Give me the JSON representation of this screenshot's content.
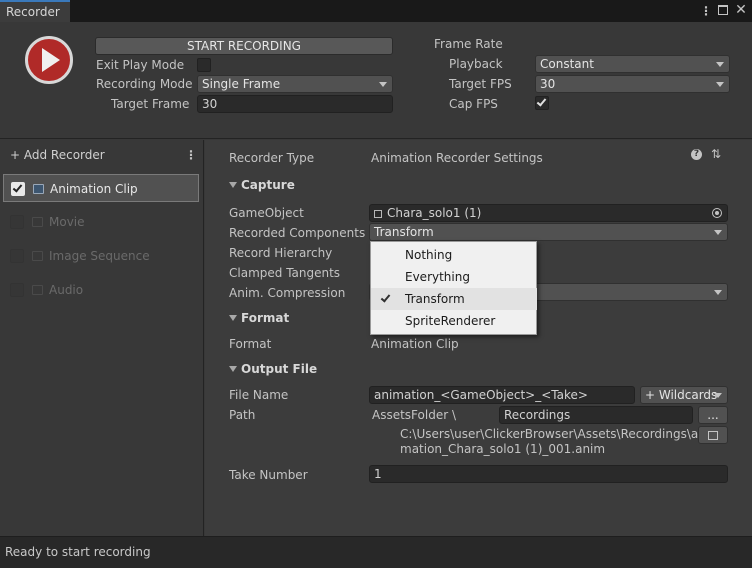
{
  "window": {
    "tab_title": "Recorder"
  },
  "top": {
    "start_button": "START RECORDING",
    "exit_play_mode_label": "Exit Play Mode",
    "exit_play_mode_checked": false,
    "recording_mode_label": "Recording Mode",
    "recording_mode_value": "Single Frame",
    "target_frame_label": "Target Frame",
    "target_frame_value": "30",
    "frame_rate_label": "Frame Rate",
    "playback_label": "Playback",
    "playback_value": "Constant",
    "target_fps_label": "Target FPS",
    "target_fps_value": "30",
    "cap_fps_label": "Cap FPS",
    "cap_fps_checked": true
  },
  "sidebar": {
    "add_recorder": "+ Add Recorder",
    "items": [
      {
        "label": "Animation Clip",
        "enabled": true,
        "selected": true
      },
      {
        "label": "Movie",
        "enabled": false,
        "selected": false
      },
      {
        "label": "Image Sequence",
        "enabled": false,
        "selected": false
      },
      {
        "label": "Audio",
        "enabled": false,
        "selected": false
      }
    ]
  },
  "inspector": {
    "recorder_type_label": "Recorder Type",
    "recorder_type_value": "Animation Recorder Settings",
    "capture_header": "Capture",
    "gameobject_label": "GameObject",
    "gameobject_value": "Chara_solo1 (1)",
    "recorded_components_label": "Recorded Components",
    "recorded_components_value": "Transform",
    "record_hierarchy_label": "Record Hierarchy",
    "clamped_tangents_label": "Clamped Tangents",
    "anim_compression_label": "Anim. Compression",
    "format_header": "Format",
    "format_label": "Format",
    "format_value": "Animation Clip",
    "output_header": "Output File",
    "file_name_label": "File Name",
    "file_name_value": "animation_<GameObject>_<Take>",
    "wildcards_label": "+ Wildcards",
    "path_label": "Path",
    "path_root": "AssetsFolder \\",
    "path_value": "Recordings",
    "browse_label": "...",
    "full_path_line1": "C:\\Users\\user\\ClickerBrowser\\Assets\\Recordings\\ani",
    "full_path_line2": "mation_Chara_solo1 (1)_001.anim",
    "take_number_label": "Take Number",
    "take_number_value": "1"
  },
  "dropdown": {
    "items": [
      {
        "label": "Nothing",
        "checked": false
      },
      {
        "label": "Everything",
        "checked": false
      },
      {
        "label": "Transform",
        "checked": true
      },
      {
        "label": "SpriteRenderer",
        "checked": false
      }
    ]
  },
  "status": {
    "text": "Ready to start recording"
  }
}
